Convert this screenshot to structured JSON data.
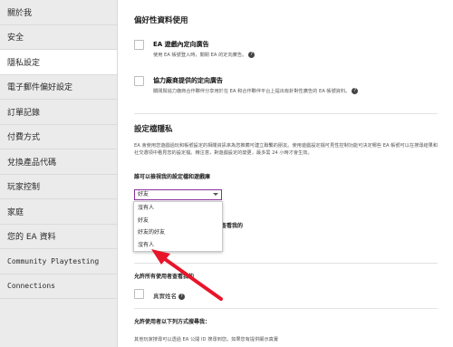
{
  "sidebar": {
    "items": [
      {
        "label": "關於我"
      },
      {
        "label": "安全"
      },
      {
        "label": "隱私設定"
      },
      {
        "label": "電子郵件偏好設定"
      },
      {
        "label": "訂單記錄"
      },
      {
        "label": "付費方式"
      },
      {
        "label": "兌換產品代碼"
      },
      {
        "label": "玩家控制"
      },
      {
        "label": "家庭"
      },
      {
        "label": "您的 EA 資料"
      },
      {
        "label": "Community Playtesting"
      },
      {
        "label": "Connections"
      }
    ],
    "active_index": 2
  },
  "main": {
    "preferences_title": "偏好性資料使用",
    "option1": {
      "title": "EA 遊戲內定向廣告",
      "desc": "使用 EA 帳號登入時，關閉 EA 的定向廣告。"
    },
    "option2": {
      "title": "協力廠商提供的定向廣告",
      "desc": "關閉與協力廠商合作夥伴分享用於在 EA 和合作夥伴平台上提出有針對性廣告的 EA 帳號資料。"
    },
    "visibility_title": "設定檔隱私",
    "visibility_desc": "EA 會使用您遊戲過玩和帳號設定的相關資訊來為您推薦可建立聯繫的朋友。使用遊戲設定檔可見性控制功能可決定哪些 EA 帳號可以在搜尋結果和社交選項中看見您的設定檔。精注意，對遊戲設定的變更，最多需 24 小時才會生效。",
    "who_can_see_label": "誰可以檢視我的設定檔和遊戲庫",
    "select": {
      "value": "好友",
      "options": [
        "沒有人",
        "好友",
        "好友的好友",
        "沒有人"
      ]
    },
    "hidden_behind_dropdown": "查看我的",
    "allow_all_label": "允許所有使用者查看我的",
    "real_name_label": "真實姓名",
    "allow_find_label": "允許使用者以下列方式搜尋我：",
    "bottom_para": "其他玩家搜尋可以透過 EA 公開 ID 搜尋到您。如果您有提供顯示真實"
  },
  "colors": {
    "accent": "#8a2d9f",
    "arrow": "#e8152a",
    "sidebar_bg": "#ebebeb"
  }
}
